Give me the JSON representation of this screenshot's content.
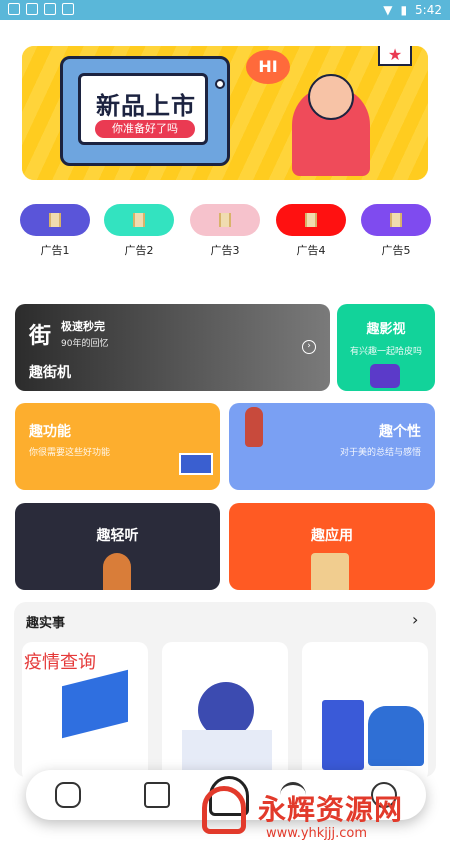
{
  "status": {
    "time": "5:42"
  },
  "banner": {
    "title": "新品上市",
    "subtitle": "你准备好了吗",
    "bubble": "HI"
  },
  "ads": [
    {
      "label": "广告1",
      "color": "#5a55d9"
    },
    {
      "label": "广告2",
      "color": "#33e3c0"
    },
    {
      "label": "广告3",
      "color": "#f6c2cc"
    },
    {
      "label": "广告4",
      "color": "#ff1111"
    },
    {
      "label": "广告5",
      "color": "#7f4bef"
    }
  ],
  "cards": {
    "arcade": {
      "icon_char": "街",
      "subtitle": "极速秒完",
      "desc": "90年的回忆",
      "title": "趣街机"
    },
    "movie": {
      "title": "趣影视",
      "desc": "有兴趣一起哈皮吗"
    },
    "function": {
      "title": "趣功能",
      "desc": "你很需要这些好功能"
    },
    "personal": {
      "title": "趣个性",
      "desc": "对于美的总结与感悟"
    },
    "listen": {
      "title": "趣轻听"
    },
    "apps": {
      "title": "趣应用"
    }
  },
  "realthings": {
    "title": "趣实事",
    "card1_label": "疫情查询"
  },
  "watermark": "永辉资源网",
  "watermark_url": "www.yhkjjj.com"
}
